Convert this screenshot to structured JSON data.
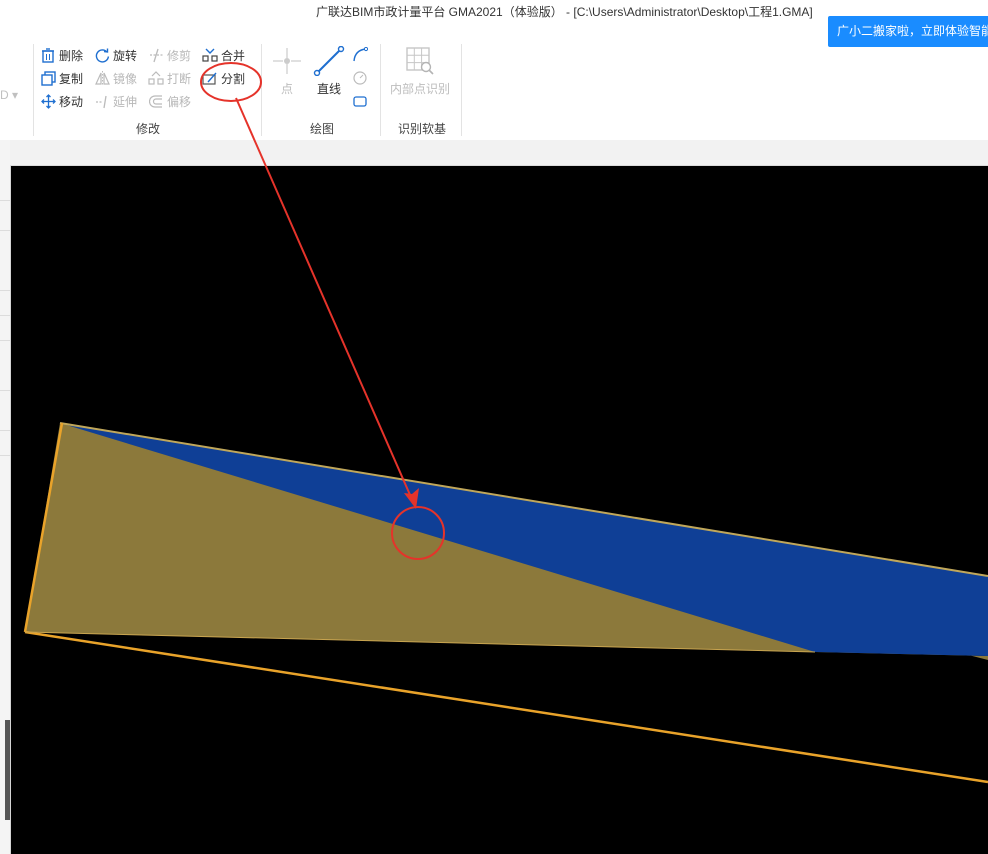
{
  "window": {
    "title": "广联达BIM市政计量平台 GMA2021（体验版） - [C:\\Users\\Administrator\\Desktop\\工程1.GMA]"
  },
  "notification": {
    "text": "广小二搬家啦，立即体验智能"
  },
  "ribbon": {
    "left_stub": "D",
    "modify": {
      "label": "修改",
      "delete": "删除",
      "rotate": "旋转",
      "trim": "修剪",
      "merge": "合并",
      "copy": "复制",
      "mirror": "镜像",
      "break": "打断",
      "split": "分割",
      "move": "移动",
      "extend": "延伸",
      "offset": "偏移"
    },
    "draw": {
      "label": "绘图",
      "point": "点",
      "line": "直线"
    },
    "identify": {
      "label": "识别软基",
      "inner_point": "内部点识别"
    }
  },
  "colors": {
    "canvas_bg": "#000000",
    "blue_region": "#0f3f96",
    "tan_region": "#8c793b",
    "outline": "#e9a32a",
    "annotation": "#e5332a",
    "notify_bg": "#1a8cff"
  }
}
